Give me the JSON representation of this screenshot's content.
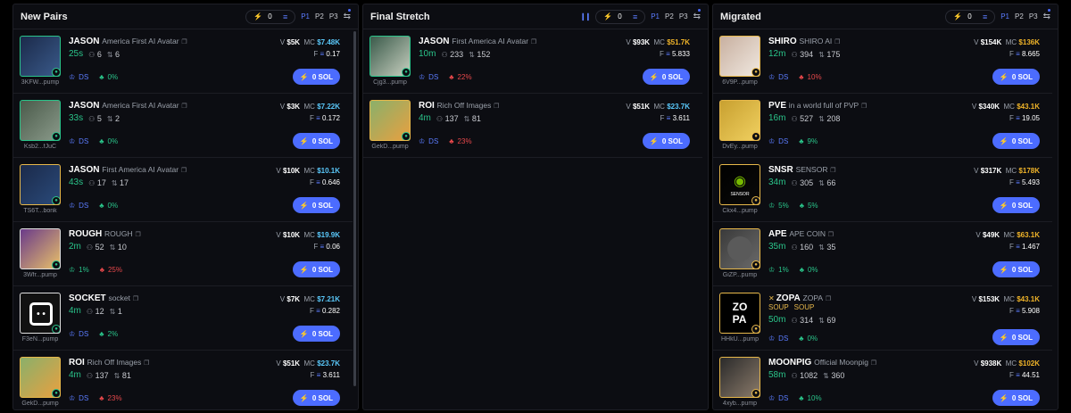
{
  "columns": [
    {
      "title": "New Pairs",
      "quick_buy": "0",
      "presets": [
        "P1",
        "P2",
        "P3"
      ],
      "tokens": [
        {
          "ticker": "JASON",
          "name": "America First AI Avatar",
          "address": "3KFW...pump",
          "age": "25s",
          "holders": "6",
          "txns": "6",
          "volume": "$5K",
          "mcap": "$7.48K",
          "fee": "0.17",
          "dev_pct": "0%",
          "ds_label": "DS",
          "buy_label": "0 SOL",
          "pct_color": "green"
        },
        {
          "ticker": "JASON",
          "name": "America First AI Avatar",
          "address": "Ksb2...fJuC",
          "age": "33s",
          "holders": "5",
          "txns": "2",
          "volume": "$3K",
          "mcap": "$7.22K",
          "fee": "0.172",
          "dev_pct": "0%",
          "ds_label": "DS",
          "buy_label": "0 SOL",
          "pct_color": "green"
        },
        {
          "ticker": "JASON",
          "name": "First America AI Avatar",
          "address": "TS6T...bonk",
          "age": "43s",
          "holders": "17",
          "txns": "17",
          "volume": "$10K",
          "mcap": "$10.1K",
          "fee": "0.646",
          "dev_pct": "0%",
          "ds_label": "DS",
          "buy_label": "0 SOL",
          "pct_color": "green"
        },
        {
          "ticker": "ROUGH",
          "name": "ROUGH",
          "address": "3Wfr...pump",
          "age": "2m",
          "holders": "52",
          "txns": "10",
          "volume": "$10K",
          "mcap": "$19.9K",
          "fee": "0.06",
          "dev_pct": "1%",
          "top_pct": "25%",
          "buy_label": "0 SOL",
          "pct_color": "green"
        },
        {
          "ticker": "SOCKET",
          "name": "socket",
          "address": "F3eN...pump",
          "age": "4m",
          "holders": "12",
          "txns": "1",
          "volume": "$7K",
          "mcap": "$7.21K",
          "fee": "0.282",
          "dev_pct": "2%",
          "ds_label": "DS",
          "buy_label": "0 SOL",
          "pct_color": "green"
        },
        {
          "ticker": "ROI",
          "name": "Rich Off Images",
          "address": "GekD...pump",
          "age": "4m",
          "holders": "137",
          "txns": "81",
          "volume": "$51K",
          "mcap": "$23.7K",
          "fee": "3.611",
          "dev_pct": "23%",
          "ds_label": "DS",
          "buy_label": "0 SOL",
          "pct_color": "red"
        }
      ]
    },
    {
      "title": "Final Stretch",
      "quick_buy": "0",
      "presets": [
        "P1",
        "P2",
        "P3"
      ],
      "tokens": [
        {
          "ticker": "JASON",
          "name": "First America AI Avatar",
          "address": "Cjg3...pump",
          "age": "10m",
          "holders": "233",
          "txns": "152",
          "volume": "$93K",
          "mcap": "$51.7K",
          "fee": "5.833",
          "dev_pct": "22%",
          "ds_label": "DS",
          "buy_label": "0 SOL",
          "pct_color": "red"
        },
        {
          "ticker": "ROI",
          "name": "Rich Off Images",
          "address": "GekD...pump",
          "age": "4m",
          "holders": "137",
          "txns": "81",
          "volume": "$51K",
          "mcap": "$23.7K",
          "fee": "3.611",
          "dev_pct": "23%",
          "ds_label": "DS",
          "buy_label": "0 SOL",
          "pct_color": "red"
        }
      ]
    },
    {
      "title": "Migrated",
      "quick_buy": "0",
      "presets": [
        "P1",
        "P2",
        "P3"
      ],
      "tokens": [
        {
          "ticker": "SHIRO",
          "name": "SHIRO AI",
          "address": "6V9P...pump",
          "age": "12m",
          "holders": "394",
          "txns": "175",
          "volume": "$154K",
          "mcap": "$136K",
          "fee": "8.665",
          "dev_pct": "10%",
          "ds_label": "DS",
          "buy_label": "0 SOL",
          "pct_color": "red"
        },
        {
          "ticker": "PVE",
          "name": "in a world full of PVP",
          "address": "DvEy...pump",
          "age": "16m",
          "holders": "527",
          "txns": "208",
          "volume": "$340K",
          "mcap": "$43.1K",
          "fee": "19.05",
          "dev_pct": "9%",
          "ds_label": "DS",
          "buy_label": "0 SOL",
          "pct_color": "green"
        },
        {
          "ticker": "SNSR",
          "name": "SENSOR",
          "address": "Ckx4...pump",
          "age": "34m",
          "holders": "305",
          "txns": "66",
          "volume": "$317K",
          "mcap": "$178K",
          "fee": "5.493",
          "dev_pct": "5%",
          "top_pct": "5%",
          "buy_label": "0 SOL",
          "pct_color": "green"
        },
        {
          "ticker": "APE",
          "name": "APE COIN",
          "address": "GiZP...pump",
          "age": "35m",
          "holders": "160",
          "txns": "35",
          "volume": "$49K",
          "mcap": "$63.1K",
          "fee": "1.467",
          "dev_pct": "1%",
          "top_pct": "0%",
          "buy_label": "0 SOL",
          "pct_color": "green"
        },
        {
          "ticker": "ZOPA",
          "name": "ZOPA",
          "tag1": "SOUP",
          "tag2": "SOUP",
          "address": "HHkU...pump",
          "age": "50m",
          "holders": "314",
          "txns": "69",
          "volume": "$153K",
          "mcap": "$43.1K",
          "fee": "5.908",
          "dev_pct": "0%",
          "ds_label": "DS",
          "buy_label": "0 SOL",
          "pct_color": "green"
        },
        {
          "ticker": "MOONPIG",
          "name": "Official Moonpig",
          "address": "4xyb...pump",
          "age": "58m",
          "holders": "1082",
          "txns": "360",
          "volume": "$938K",
          "mcap": "$102K",
          "fee": "44.51",
          "dev_pct": "10%",
          "ds_label": "DS",
          "buy_label": "0 SOL",
          "pct_color": "green"
        }
      ]
    }
  ],
  "labels": {
    "v": "V",
    "mc": "MC",
    "f": "F"
  },
  "colors": {
    "accent": "#4c6cff",
    "green": "#2ac48a",
    "red": "#e8484b",
    "gold": "#f0b429",
    "mc_blue": "#5ac8fa"
  }
}
